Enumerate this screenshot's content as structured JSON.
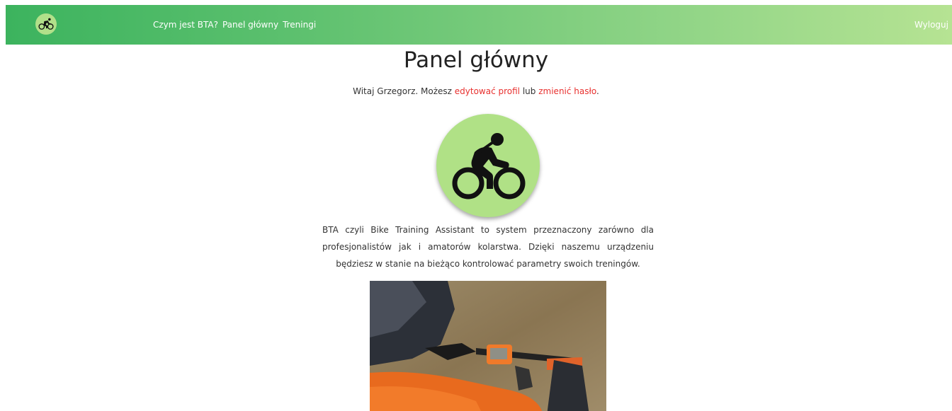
{
  "navbar": {
    "brand_icon": "bicycle-icon",
    "links": [
      "Czym jest BTA?",
      "Panel główny",
      "Treningi"
    ],
    "logout_label": "Wyloguj"
  },
  "page_title": "Panel główny",
  "welcome": {
    "prefix": "Witaj Grzegorz. Możesz",
    "edit_profile_link": "edytować profil",
    "middle": "lub",
    "change_password_link": "zmienić hasło",
    "suffix": "."
  },
  "hero_icon": "cyclist-icon",
  "description": "BTA czyli Bike Training Assistant to system przeznaczony zarówno dla profesjonalistów jak i amatorów kolarstwa. Dzięki naszemu urządzeniu będziesz w stanie na bieżąco kontrolować parametry swoich treningów.",
  "colors": {
    "nav_gradient_start": "#3cb35e",
    "nav_gradient_end": "#b6e393",
    "link_accent": "#e8312f",
    "icon_circle": "#b0e186"
  }
}
